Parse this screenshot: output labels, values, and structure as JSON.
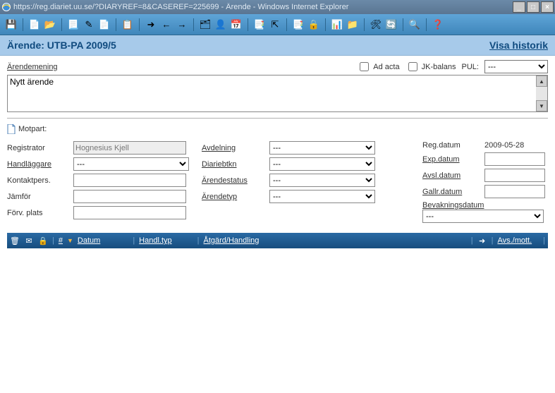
{
  "window": {
    "url_title": "https://reg.diariet.uu.se/?DIARYREF=8&CASEREF=225699 - Ärende - Windows Internet Explorer",
    "minimize": "_",
    "maximize": "□",
    "close": "×"
  },
  "toolbar": {
    "items": [
      {
        "name": "save-icon",
        "glyph": "💾"
      },
      {
        "name": "new-doc-icon",
        "glyph": "📄"
      },
      {
        "name": "open-icon",
        "glyph": "📂"
      },
      {
        "name": "page-icon",
        "glyph": "📃"
      },
      {
        "name": "edit-icon",
        "glyph": "✎"
      },
      {
        "name": "copy-page-icon",
        "glyph": "📄"
      },
      {
        "name": "list-icon",
        "glyph": "📋"
      },
      {
        "name": "arrow-right-blue-icon",
        "glyph": "➜"
      },
      {
        "name": "arrow-left-red-icon",
        "glyph": "←"
      },
      {
        "name": "arrow-right-green-icon",
        "glyph": "→"
      },
      {
        "name": "card-icon",
        "glyph": "🗂"
      },
      {
        "name": "person-icon",
        "glyph": "👤"
      },
      {
        "name": "calendar-icon",
        "glyph": "📅"
      },
      {
        "name": "list2-icon",
        "glyph": "📑"
      },
      {
        "name": "export-icon",
        "glyph": "⇱"
      },
      {
        "name": "copy-multi-icon",
        "glyph": "📑"
      },
      {
        "name": "lock-icon",
        "glyph": "🔒"
      },
      {
        "name": "chart-icon",
        "glyph": "📊"
      },
      {
        "name": "folder-icon",
        "glyph": "📁"
      },
      {
        "name": "tool-icon",
        "glyph": "🛠"
      },
      {
        "name": "refresh-icon",
        "glyph": "🔄"
      },
      {
        "name": "search-icon",
        "glyph": "🔍"
      },
      {
        "name": "help-icon",
        "glyph": "❓"
      }
    ]
  },
  "header": {
    "title": "Ärende: UTB-PA 2009/5",
    "history_link": "Visa historik"
  },
  "top_fields": {
    "arendemening_label": "Ärendemening",
    "arendemening_value": "Nytt ärende",
    "ad_acta_label": "Ad acta",
    "jk_balans_label": "JK-balans",
    "pul_label": "PUL:",
    "pul_value": "---"
  },
  "motpart": {
    "label": "Motpart:"
  },
  "col1": {
    "registrator_label": "Registrator",
    "registrator_value": "Hognesius Kjell",
    "handlaggare_label": "Handläggare",
    "handlaggare_value": "---",
    "kontaktpers_label": "Kontaktpers.",
    "kontaktpers_value": "",
    "jamfor_label": "Jämför",
    "jamfor_value": "",
    "forv_plats_label": "Förv. plats",
    "forv_plats_value": ""
  },
  "col2": {
    "avdelning_label": "Avdelning",
    "avdelning_value": "---",
    "diariebtkn_label": "Diariebtkn",
    "diariebtkn_value": "---",
    "arendestatus_label": "Ärendestatus",
    "arendestatus_value": "---",
    "arendetyp_label": "Ärendetyp",
    "arendetyp_value": "---"
  },
  "col3": {
    "reg_datum_label": "Reg.datum",
    "reg_datum_value": "2009-05-28",
    "exp_datum_label": "Exp.datum",
    "exp_datum_value": "",
    "avsl_datum_label": "Avsl.datum",
    "avsl_datum_value": "",
    "gallr_datum_label": "Gallr.datum",
    "gallr_datum_value": "",
    "bevak_label": "Bevakningsdatum",
    "bevak_value": "---"
  },
  "tablehead": {
    "num": "#",
    "datum": "Datum",
    "handltyp": "Handl.typ",
    "atgard": "Åtgärd/Handling",
    "avsmott": "Avs./mott."
  }
}
